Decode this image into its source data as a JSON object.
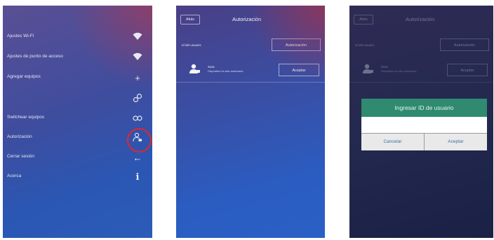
{
  "screen1": {
    "menu": [
      {
        "label": "Ajustes Wi-Fi",
        "icon": "wifi-icon"
      },
      {
        "label": "Ajustes de punto de acceso",
        "icon": "wifi-icon"
      },
      {
        "label": "Agregar equipos",
        "icon": "plus-icon"
      },
      {
        "label": "",
        "icon": "link-icon"
      },
      {
        "label": "Switchear equipos",
        "icon": "switch-icon"
      },
      {
        "label": "Autorización",
        "icon": "user-lock-icon"
      },
      {
        "label": "Cerrar sesión",
        "icon": "arrow-left-icon"
      },
      {
        "label": "Acerca",
        "icon": "info-icon"
      }
    ]
  },
  "screen2": {
    "back_label": "Atrás",
    "title": "Autorización",
    "user_id": "Id del usuario:",
    "authorize_label": "Autorización",
    "user": {
      "name": "Sora",
      "detail": "Dispositivo ha sido autorizado",
      "accept_label": "Aceptar"
    }
  },
  "screen3": {
    "back_label": "Atrás",
    "title": "Autorización",
    "user_id": "Id del usuario:",
    "authorize_label": "Autorización",
    "user": {
      "name": "Sora",
      "detail": "Dispositivo ha sido autorizado",
      "accept_label": "Aceptar"
    },
    "dialog": {
      "title": "Ingresar ID de usuario",
      "input_value": "",
      "cancel_label": "Cancelar",
      "accept_label": "Aceptar"
    }
  },
  "colors": {
    "dialog_header": "#2f8a6f",
    "highlight_circle": "#e3262c",
    "dialog_button_text": "#3a6fa0"
  }
}
